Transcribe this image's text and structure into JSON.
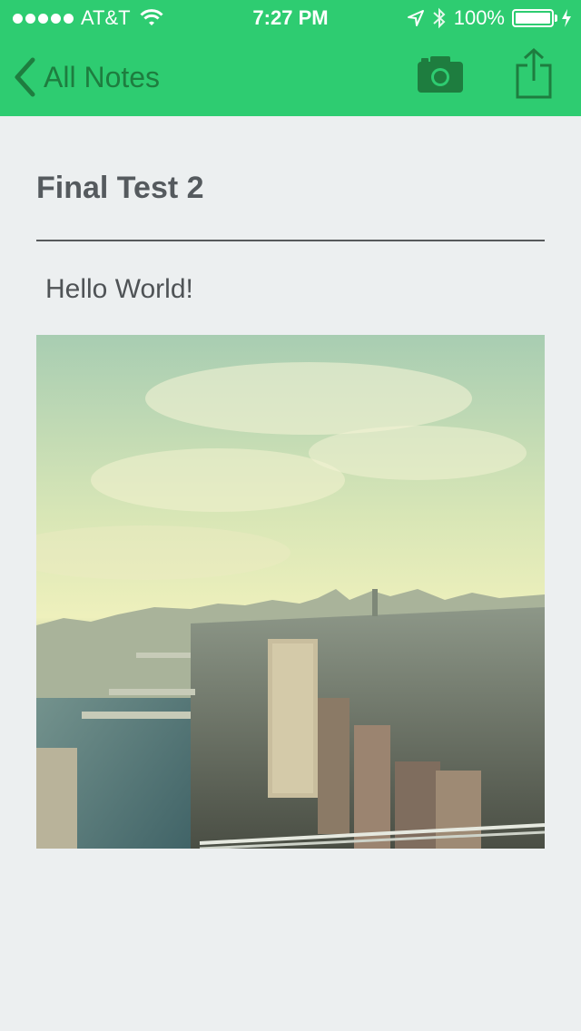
{
  "status_bar": {
    "carrier": "AT&T",
    "time": "7:27 PM",
    "battery": "100%"
  },
  "nav": {
    "back_label": "All Notes"
  },
  "note": {
    "title": "Final Test 2",
    "body": "Hello World!",
    "attachment": "city-skyline-photo"
  },
  "colors": {
    "accent": "#2ECC71",
    "nav_icon": "#1E7D3F",
    "background": "#ECEFF0"
  }
}
